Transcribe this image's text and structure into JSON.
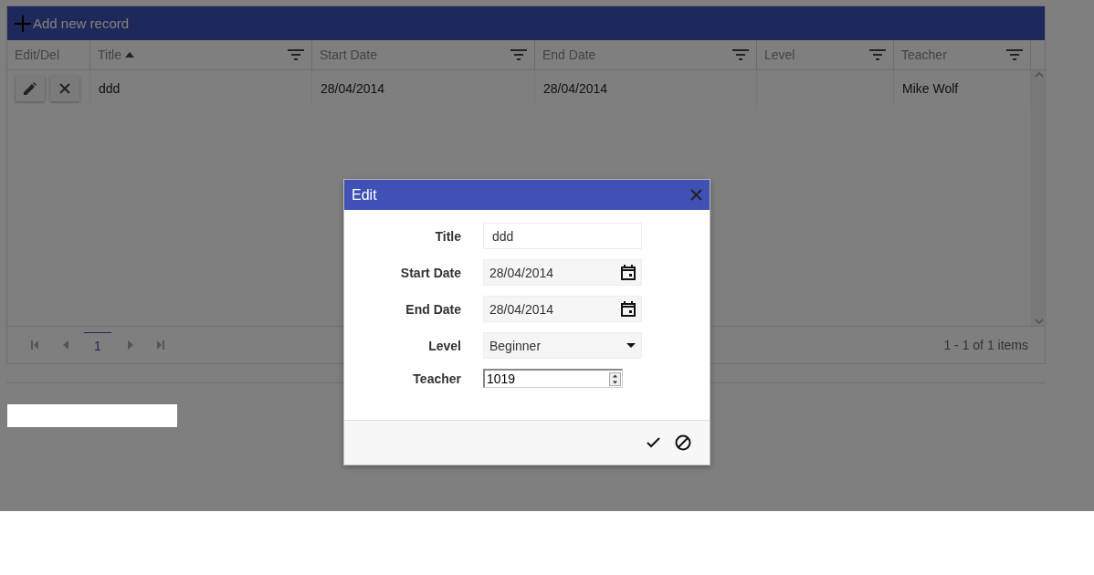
{
  "toolbar": {
    "add_button": "Add new record"
  },
  "grid": {
    "columns": [
      {
        "label": "Edit/Del",
        "filterable": false,
        "sorted": false
      },
      {
        "label": "Title",
        "filterable": true,
        "sorted": true
      },
      {
        "label": "Start Date",
        "filterable": true,
        "sorted": false
      },
      {
        "label": "End Date",
        "filterable": true,
        "sorted": false
      },
      {
        "label": "Level",
        "filterable": true,
        "sorted": false
      },
      {
        "label": "Teacher",
        "filterable": true,
        "sorted": false
      }
    ],
    "rows": [
      {
        "cells": [
          "",
          "ddd",
          "28/04/2014",
          "28/04/2014",
          "",
          "Mike Wolf"
        ]
      }
    ],
    "pager": {
      "pages": [
        {
          "label": "1",
          "selected": true
        }
      ],
      "summary": "1 - 1 of 1 items"
    }
  },
  "dialog": {
    "title": "Edit",
    "fields": [
      {
        "label": "Title",
        "kind": "text",
        "value": "ddd"
      },
      {
        "label": "Start Date",
        "kind": "date",
        "value": "28/04/2014"
      },
      {
        "label": "End Date",
        "kind": "date",
        "value": "28/04/2014"
      },
      {
        "label": "Level",
        "kind": "dropdown",
        "value": "Beginner"
      },
      {
        "label": "Teacher",
        "kind": "numeric",
        "value": "1019"
      }
    ]
  }
}
